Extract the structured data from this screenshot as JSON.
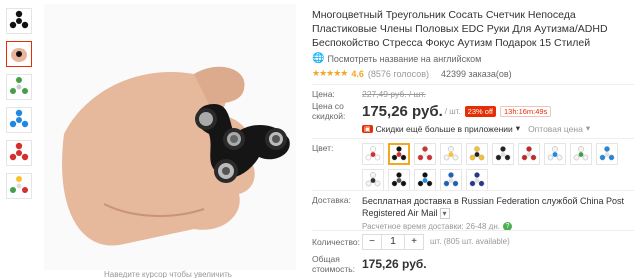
{
  "product": {
    "title": "Многоцветный Треугольник Сосать Счетчик Непоседа Пластиковые Члены Половых EDC Руки Для Аутизма/ADHD Беспокойство Стресса Фокус Аутизм Подарок 15 Стилей",
    "translate_link": "Посмотреть название на английском",
    "rating": "4.6",
    "reviews": "(8576 голосов)",
    "orders": "42399 заказа(ов)"
  },
  "price": {
    "label": "Цена:",
    "old": "227,49 руб. / шт.",
    "discount_label": "Цена со скидкой:",
    "current": "175,26 руб.",
    "unit": "/ шт.",
    "off": "23% off",
    "timer": "13h:16m:49s",
    "app_text": "Скидки ещё больше в приложении",
    "wholesale": "Оптовая цена"
  },
  "color": {
    "label": "Цвет:",
    "swatches": [
      {
        "name": "white-red",
        "c1": "#ffffff",
        "c2": "#d32f2f"
      },
      {
        "name": "black-red",
        "c1": "#111111",
        "c2": "#d32f2f",
        "selected": true
      },
      {
        "name": "red-white",
        "c1": "#d32f2f",
        "c2": "#eeeeee"
      },
      {
        "name": "white-yellow",
        "c1": "#f5f5f5",
        "c2": "#fbc02d"
      },
      {
        "name": "yellow",
        "c1": "#fbc02d",
        "c2": "#222222"
      },
      {
        "name": "black-white",
        "c1": "#222222",
        "c2": "#e0e0e0"
      },
      {
        "name": "red",
        "c1": "#c62828",
        "c2": "#e0e0e0"
      },
      {
        "name": "white-blue",
        "c1": "#f5f5f5",
        "c2": "#1e88e5"
      },
      {
        "name": "white-green",
        "c1": "#f5f5f5",
        "c2": "#43a047"
      },
      {
        "name": "blue",
        "c1": "#1e88e5",
        "c2": "#e0e0e0"
      },
      {
        "name": "white-black",
        "c1": "#f5f5f5",
        "c2": "#333333"
      },
      {
        "name": "black",
        "c1": "#111111",
        "c2": "#555555"
      },
      {
        "name": "black-blue",
        "c1": "#111111",
        "c2": "#1e88e5"
      },
      {
        "name": "blue-dark",
        "c1": "#1565c0",
        "c2": "#e0e0e0"
      },
      {
        "name": "royal-blue",
        "c1": "#283593",
        "c2": "#e0e0e0"
      }
    ]
  },
  "shipping": {
    "label": "Доставка:",
    "main": "Бесплатная доставка в Russian Federation службой China Post Registered Air Mail",
    "estimate": "Расчетное время доставки: 26-48 дн."
  },
  "quantity": {
    "label": "Количество:",
    "minus": "−",
    "value": "1",
    "plus": "+",
    "note": "шт. (805 шт. available)"
  },
  "total": {
    "label": "Общая стоимость:",
    "value": "175,26 руб."
  },
  "image_caption": "Наведите курсор чтобы увеличить",
  "colors": {
    "accent": "#e62e04",
    "star": "#f5a623",
    "link": "#2d7dd2"
  }
}
